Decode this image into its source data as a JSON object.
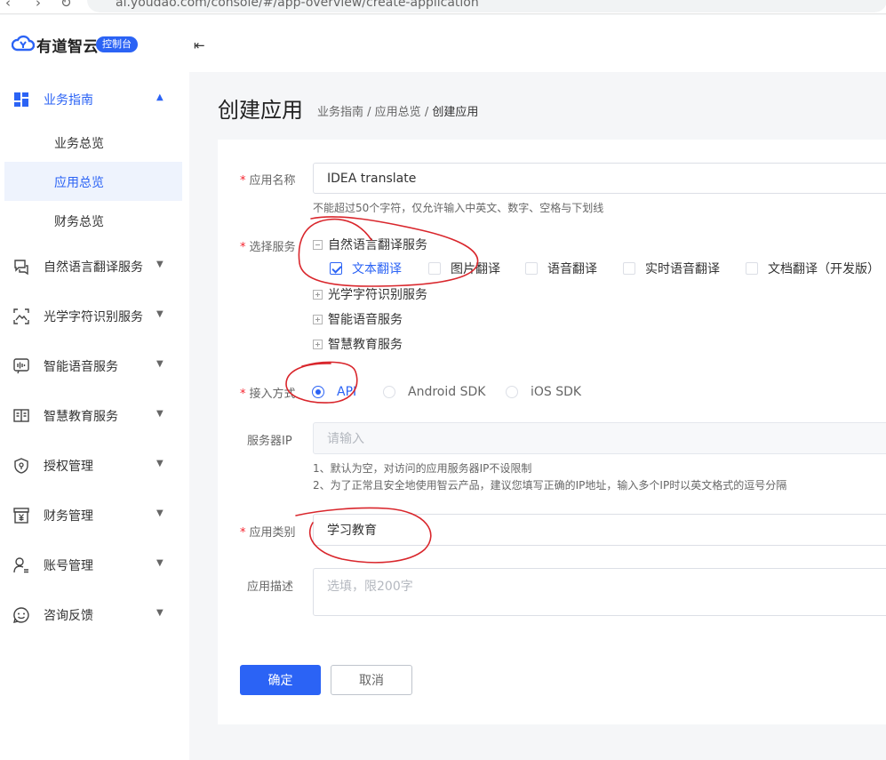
{
  "browser": {
    "url": "ai.youdao.com/console/#/app-overview/create-application"
  },
  "brand": {
    "name": "有道智云",
    "badge": "控制台",
    "accent": "#2b63f5"
  },
  "sidebar": {
    "items": [
      {
        "label": "业务指南",
        "icon": "dashboard-icon",
        "open": true,
        "children": [
          {
            "label": "业务总览"
          },
          {
            "label": "应用总览",
            "active": true
          },
          {
            "label": "财务总览"
          }
        ]
      },
      {
        "label": "自然语言翻译服务",
        "icon": "translate-chat-icon"
      },
      {
        "label": "光学字符识别服务",
        "icon": "ocr-scan-icon"
      },
      {
        "label": "智能语音服务",
        "icon": "voice-wave-icon"
      },
      {
        "label": "智慧教育服务",
        "icon": "education-book-icon"
      },
      {
        "label": "授权管理",
        "icon": "shield-icon"
      },
      {
        "label": "财务管理",
        "icon": "finance-yen-icon"
      },
      {
        "label": "账号管理",
        "icon": "user-account-icon"
      },
      {
        "label": "咨询反馈",
        "icon": "smiley-feedback-icon"
      }
    ]
  },
  "page": {
    "title": "创建应用",
    "breadcrumb": {
      "part1": "业务指南",
      "sep1": " / ",
      "part2": "应用总览",
      "sep2": " / ",
      "current": "创建应用"
    }
  },
  "form": {
    "app_name": {
      "label": "应用名称",
      "value": "IDEA translate",
      "hint": "不能超过50个字符，仅允许输入中英文、数字、空格与下划线"
    },
    "service": {
      "label": "选择服务",
      "groups": [
        {
          "label": "自然语言翻译服务",
          "expanded": true,
          "options": [
            {
              "label": "文本翻译",
              "checked": true
            },
            {
              "label": "图片翻译",
              "checked": false
            },
            {
              "label": "语音翻译",
              "checked": false
            },
            {
              "label": "实时语音翻译",
              "checked": false
            },
            {
              "label": "文档翻译（开发版）",
              "checked": false
            }
          ]
        },
        {
          "label": "光学字符识别服务",
          "expanded": false
        },
        {
          "label": "智能语音服务",
          "expanded": false
        },
        {
          "label": "智慧教育服务",
          "expanded": false
        }
      ]
    },
    "access": {
      "label": "接入方式",
      "options": [
        {
          "label": "API",
          "checked": true
        },
        {
          "label": "Android SDK"
        },
        {
          "label": "iOS SDK"
        }
      ]
    },
    "server_ip": {
      "label": "服务器IP",
      "placeholder": "请输入",
      "hint1": "1、默认为空，对访问的应用服务器IP不设限制",
      "hint2": "2、为了正常且安全地使用智云产品，建议您填写正确的IP地址，输入多个IP时以英文格式的逗号分隔"
    },
    "category": {
      "label": "应用类别",
      "value": "学习教育"
    },
    "description": {
      "label": "应用描述",
      "placeholder": "选填，限200字"
    },
    "buttons": {
      "confirm": "确定",
      "cancel": "取消"
    }
  },
  "annotation_color": "#d9262c"
}
